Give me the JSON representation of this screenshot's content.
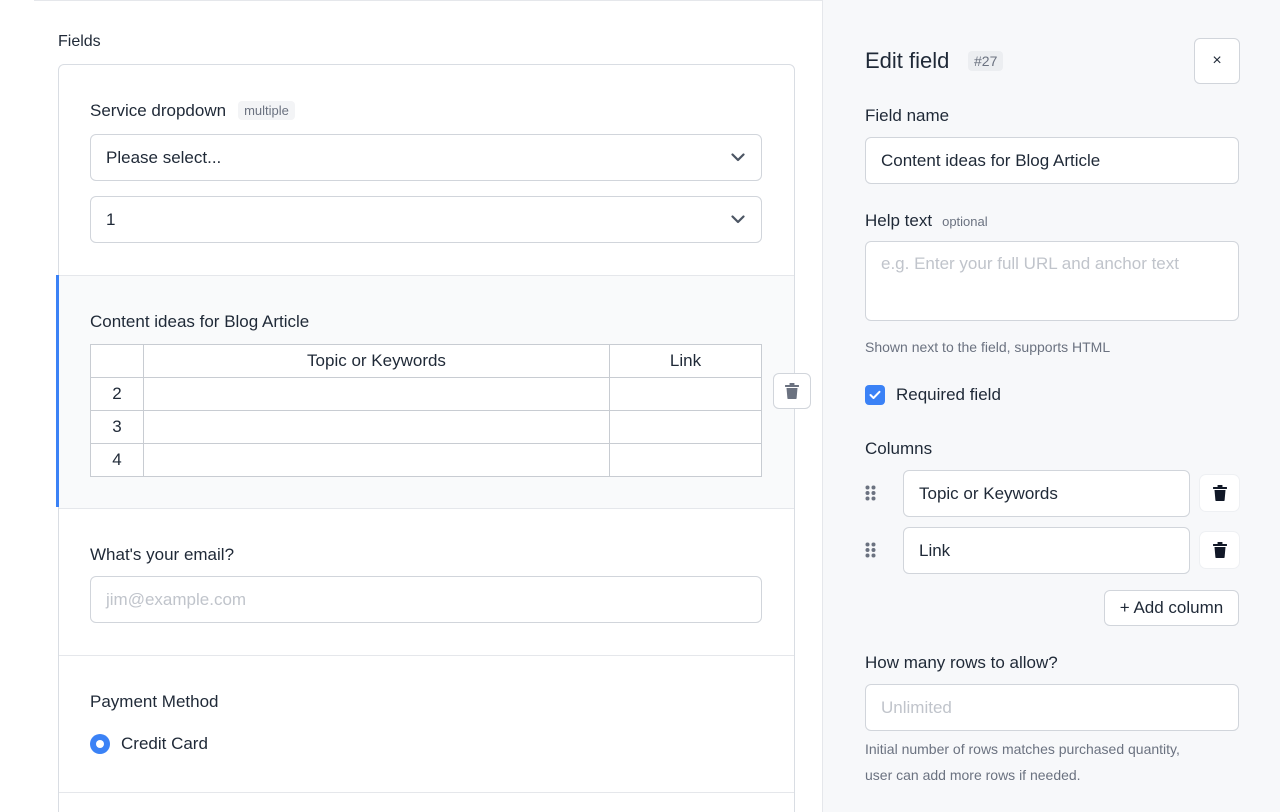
{
  "fields_panel": {
    "title": "Fields",
    "service": {
      "label": "Service dropdown",
      "tag": "multiple",
      "select1_value": "Please select...",
      "select2_value": "1"
    },
    "content": {
      "label": "Content ideas for Blog Article",
      "table": {
        "columns": [
          "Topic or Keywords",
          "Link"
        ],
        "rows": [
          {
            "num": "2",
            "topic": "",
            "link": ""
          },
          {
            "num": "3",
            "topic": "",
            "link": ""
          },
          {
            "num": "4",
            "topic": "",
            "link": ""
          }
        ]
      }
    },
    "email": {
      "label": "What's your email?",
      "placeholder": "jim@example.com"
    },
    "payment": {
      "label": "Payment Method",
      "option": "Credit Card"
    }
  },
  "edit_panel": {
    "title": "Edit field",
    "badge": "#27",
    "close_label": "×",
    "field_name_label": "Field name",
    "field_name_value": "Content ideas for Blog Article",
    "help_label": "Help text",
    "help_optional": "optional",
    "help_placeholder": "e.g. Enter your full URL and anchor text",
    "help_hint": "Shown next to the field, supports HTML",
    "required_label": "Required field",
    "columns_label": "Columns",
    "columns": [
      "Topic or Keywords",
      "Link"
    ],
    "add_column_label": "+ Add column",
    "rows_label": "How many rows to allow?",
    "rows_placeholder": "Unlimited",
    "rows_hint_1": "Initial number of rows matches purchased quantity,",
    "rows_hint_2": "user can add more rows if needed."
  },
  "colors": {
    "accent": "#3b82f6",
    "panel_bg": "#f7f8fa",
    "border": "#d1d5db"
  },
  "icons": [
    "chevron-down-icon",
    "trash-icon",
    "close-icon",
    "check-icon",
    "drag-handle-icon"
  ]
}
